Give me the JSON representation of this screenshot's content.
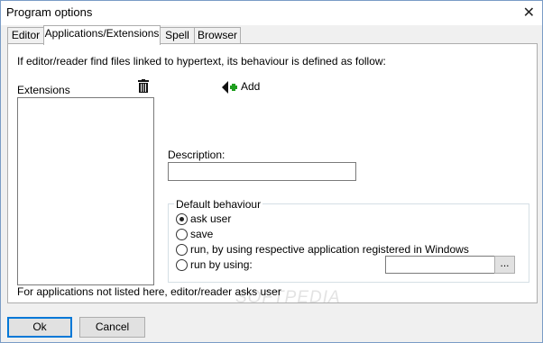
{
  "window": {
    "title": "Program options",
    "close_glyph": "✕"
  },
  "tabs": [
    {
      "label": "Editor",
      "active": false
    },
    {
      "label": "Applications/Extensions",
      "active": true
    },
    {
      "label": "Spell",
      "active": false
    },
    {
      "label": "Browser",
      "active": false
    }
  ],
  "panel": {
    "intro": "If editor/reader find files linked to hypertext, its behaviour is defined as follow:",
    "extensions_label": "Extensions",
    "trash_icon": "trash-icon",
    "add_label": "Add",
    "add_icon": "add-arrow-icon",
    "description_label": "Description:",
    "description_value": "",
    "group_title": "Default behaviour",
    "options": [
      {
        "label": "ask user",
        "selected": true
      },
      {
        "label": "save",
        "selected": false
      },
      {
        "label": "run, by using respective application registered in Windows",
        "selected": false
      },
      {
        "label": "run by using:",
        "selected": false
      }
    ],
    "run_path_value": "",
    "browse_label": "...",
    "footer_note": "For applications not listed here, editor/reader asks user",
    "watermark": "SOFTPEDIA"
  },
  "buttons": {
    "ok": "Ok",
    "cancel": "Cancel"
  },
  "colors": {
    "accent": "#0078d7",
    "add_green": "#1e9e1e"
  }
}
